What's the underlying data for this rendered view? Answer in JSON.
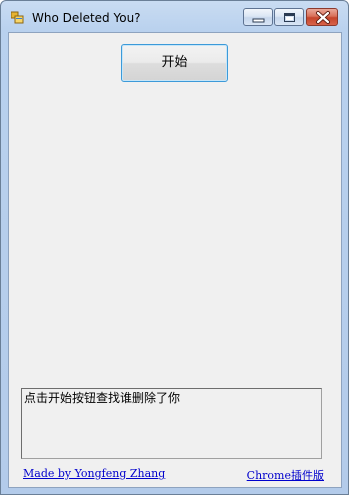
{
  "window": {
    "title": "Who Deleted You?",
    "controls": {
      "minimize_icon": "minimize-icon",
      "maximize_icon": "maximize-icon",
      "close_icon": "close-icon"
    }
  },
  "main": {
    "start_label": "开始",
    "status_text": "点击开始按钮查找谁删除了你"
  },
  "footer": {
    "credit_link": "Made by Yongfeng Zhang",
    "chrome_link": "Chrome插件版"
  },
  "colors": {
    "link": "#0000cc",
    "button_focus_border": "#3c9ad9",
    "close_button": "#c5442b"
  }
}
